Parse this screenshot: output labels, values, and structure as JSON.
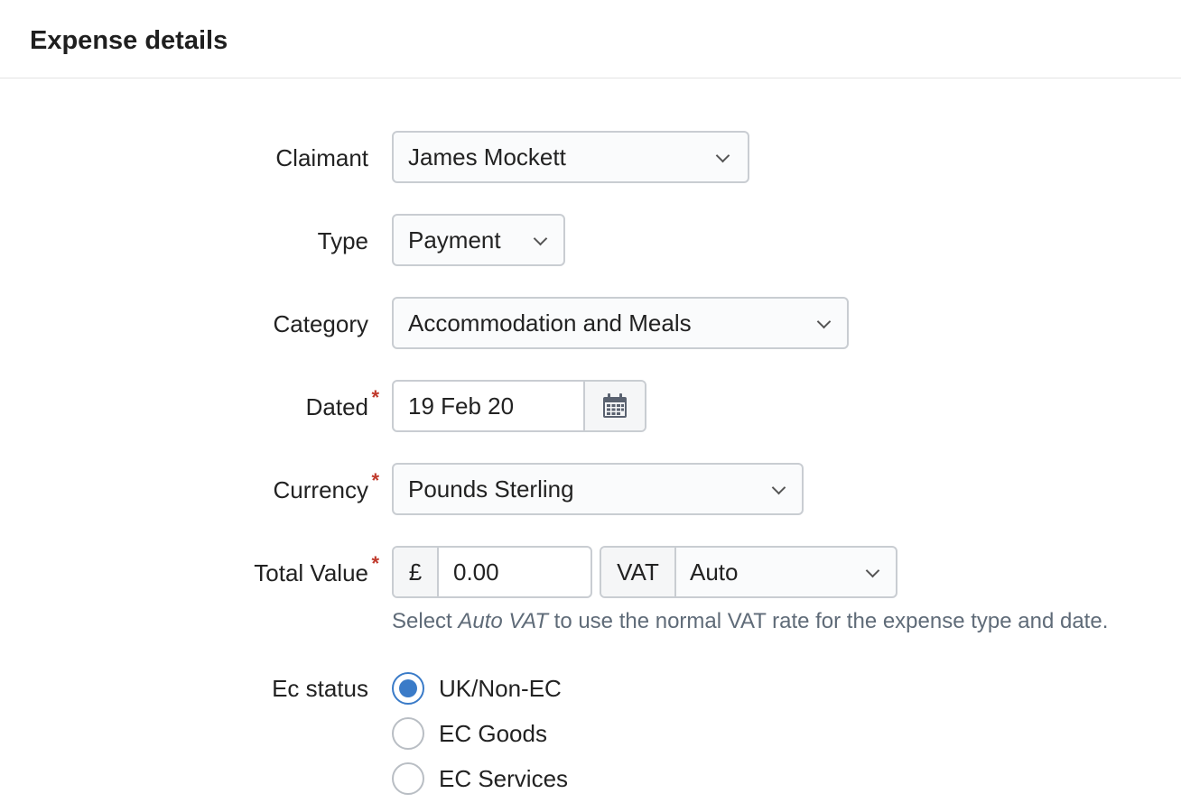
{
  "header": {
    "title": "Expense details"
  },
  "fields": {
    "claimant": {
      "label": "Claimant",
      "value": "James Mockett"
    },
    "type": {
      "label": "Type",
      "value": "Payment"
    },
    "category": {
      "label": "Category",
      "value": "Accommodation and Meals"
    },
    "dated": {
      "label": "Dated",
      "value": "19 Feb 20",
      "required": true
    },
    "currency": {
      "label": "Currency",
      "value": "Pounds Sterling",
      "required": true
    },
    "total_value": {
      "label": "Total Value",
      "required": true,
      "currency_symbol": "£",
      "value": "0.00",
      "vat_label": "VAT",
      "vat_value": "Auto"
    },
    "help": {
      "prefix": "Select ",
      "emphasis": "Auto VAT",
      "suffix": " to use the normal VAT rate for the expense type and date."
    },
    "ec_status": {
      "label": "Ec status",
      "options": [
        "UK/Non-EC",
        "EC Goods",
        "EC Services"
      ],
      "selected": "UK/Non-EC"
    }
  },
  "icons": {
    "select_caret": "chevron-down-icon",
    "date_picker": "calendar-icon"
  },
  "colors": {
    "required_marker": "#c0392b",
    "radio_selected": "#3a7bc8",
    "help_text": "#5f6b78"
  }
}
